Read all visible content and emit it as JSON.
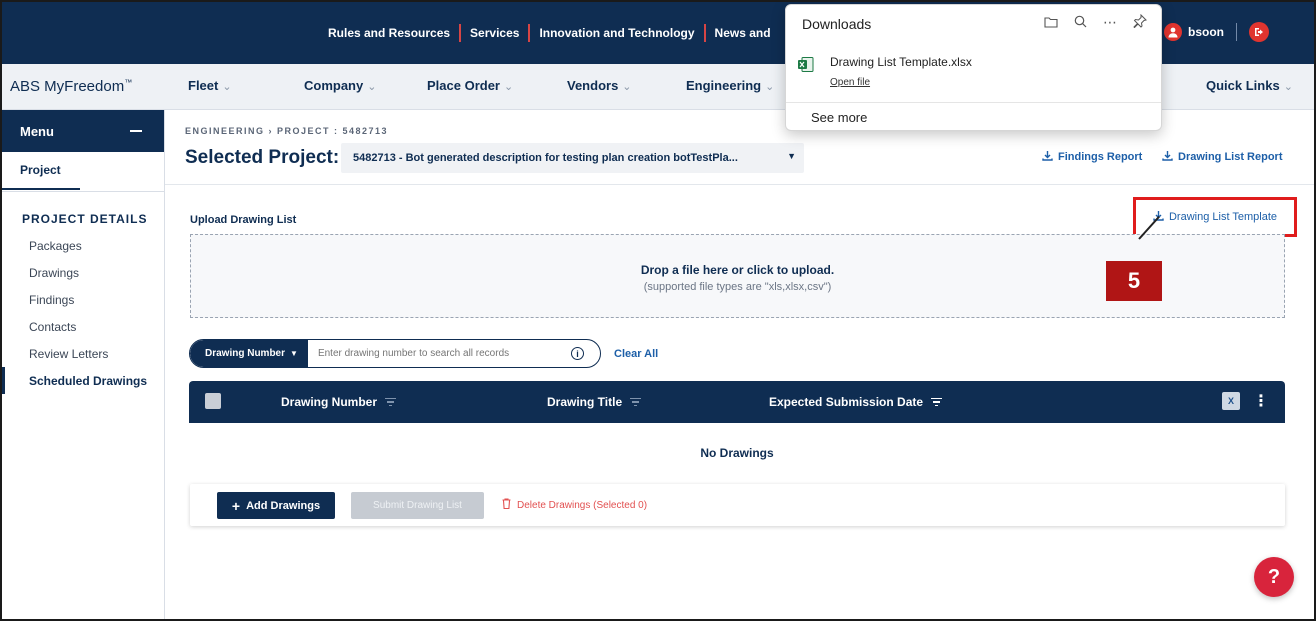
{
  "topbar": {
    "links": [
      "Rules and Resources",
      "Services",
      "Innovation and Technology",
      "News and"
    ],
    "user_name": "bsoon"
  },
  "nav": {
    "brand": "ABS MyFreedom",
    "brand_tm": "™",
    "items": [
      "Fleet",
      "Company",
      "Place Order",
      "Vendors",
      "Engineering"
    ],
    "quick_links": "Quick Links"
  },
  "sidebar": {
    "menu_label": "Menu",
    "project_tab": "Project",
    "section_title": "PROJECT DETAILS",
    "items": [
      "Packages",
      "Drawings",
      "Findings",
      "Contacts",
      "Review Letters",
      "Scheduled Drawings"
    ],
    "active_item": "Scheduled Drawings"
  },
  "header": {
    "breadcrumb": "ENGINEERING  ›  PROJECT : 5482713",
    "selected_label": "Selected Project:",
    "selected_value": "5482713 - Bot generated description for testing plan creation botTestPla...",
    "findings_report": "Findings Report",
    "drawing_list_report": "Drawing List Report"
  },
  "upload": {
    "label": "Upload Drawing List",
    "template_link": "Drawing List Template",
    "drop_title": "Drop a file here or click to upload.",
    "drop_hint": "(supported file types are \"xls,xlsx,csv\")"
  },
  "callout": {
    "number": "5"
  },
  "search": {
    "field_selector": "Drawing Number",
    "placeholder": "Enter drawing number to search all records",
    "clear_all": "Clear All"
  },
  "table": {
    "columns": [
      "Drawing Number",
      "Drawing Title",
      "Expected Submission Date"
    ],
    "empty_message": "No Drawings"
  },
  "actions": {
    "add": "Add Drawings",
    "submit": "Submit Drawing List",
    "delete": "Delete Drawings (Selected 0)"
  },
  "help": {
    "label": "?"
  },
  "downloads_panel": {
    "title": "Downloads",
    "file_name": "Drawing List Template.xlsx",
    "open_file": "Open file",
    "see_more": "See more"
  },
  "colors": {
    "navy": "#0f2d52",
    "accent_red": "#e01c1c",
    "link_blue": "#1d5fa8",
    "help_red": "#d8243c"
  }
}
